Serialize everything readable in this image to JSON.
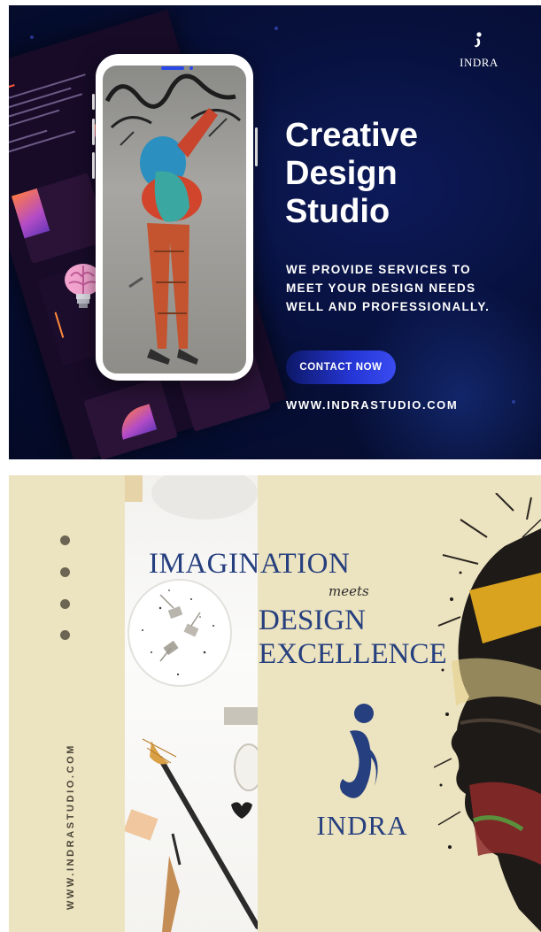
{
  "panel1": {
    "brand": "INDRA",
    "headline": [
      "Creative",
      "Design",
      "Studio"
    ],
    "subtext": [
      "WE PROVIDE SERVICES TO",
      "MEET YOUR DESIGN NEEDS",
      "WELL AND PROFESSIONALLY."
    ],
    "cta_label": "CONTACT NOW",
    "url": "WWW.INDRASTUDIO.COM",
    "colors": {
      "background": "#07103a",
      "accent": "#2a48e8",
      "text": "#ffffff"
    }
  },
  "panel2": {
    "title_line1": "IMAGINATION",
    "title_connector": "meets",
    "title_line2": "DESIGN",
    "title_line3": "EXCELLENCE",
    "brand": "INDRA",
    "vertical_url": "WWW.INDRASTUDIO.COM",
    "colors": {
      "background": "#ece3c0",
      "title": "#263f7e",
      "bullets": "#6d6553"
    }
  }
}
